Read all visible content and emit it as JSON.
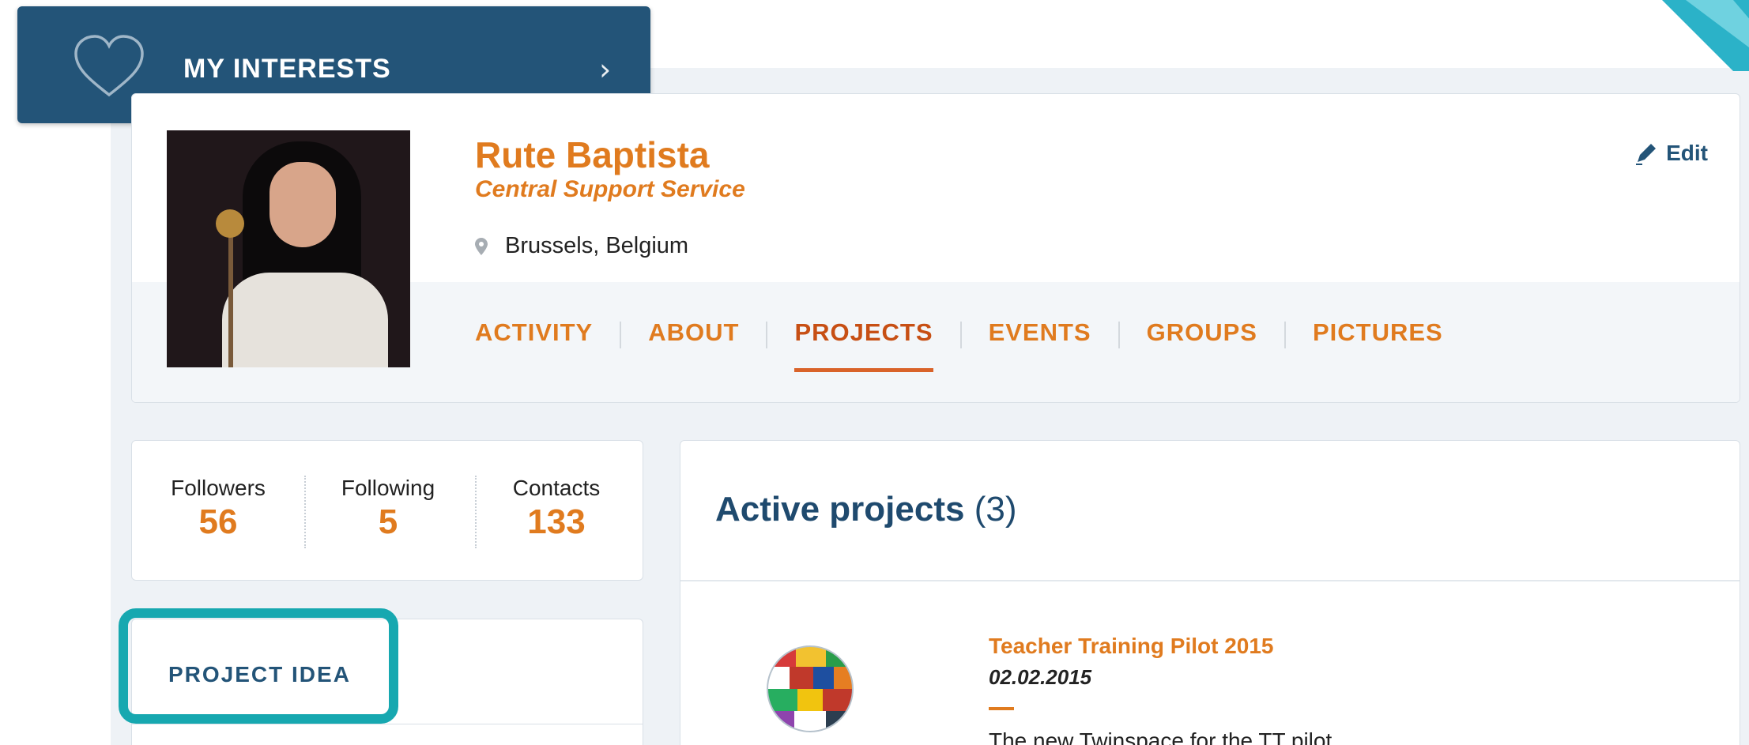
{
  "interests": {
    "label": "MY INTERESTS"
  },
  "profile": {
    "name": "Rute Baptista",
    "department": "Central Support Service",
    "location": "Brussels, Belgium",
    "edit_label": "Edit"
  },
  "tabs": [
    {
      "label": "ACTIVITY",
      "active": false
    },
    {
      "label": "ABOUT",
      "active": false
    },
    {
      "label": "PROJECTS",
      "active": true
    },
    {
      "label": "EVENTS",
      "active": false
    },
    {
      "label": "GROUPS",
      "active": false
    },
    {
      "label": "PICTURES",
      "active": false
    }
  ],
  "stats": [
    {
      "label": "Followers",
      "value": "56"
    },
    {
      "label": "Following",
      "value": "5"
    },
    {
      "label": "Contacts",
      "value": "133"
    }
  ],
  "sidebar": {
    "project_idea_label": "PROJECT IDEA"
  },
  "projects": {
    "title": "Active projects",
    "count": "(3)",
    "items": [
      {
        "title": "Teacher Training Pilot 2015",
        "date": "02.02.2015",
        "description": "The new Twinspace for the TT pilot"
      }
    ]
  },
  "colors": {
    "accent_orange": "#e07b1f",
    "navy": "#235478",
    "highlight_teal": "#17a8b0"
  }
}
